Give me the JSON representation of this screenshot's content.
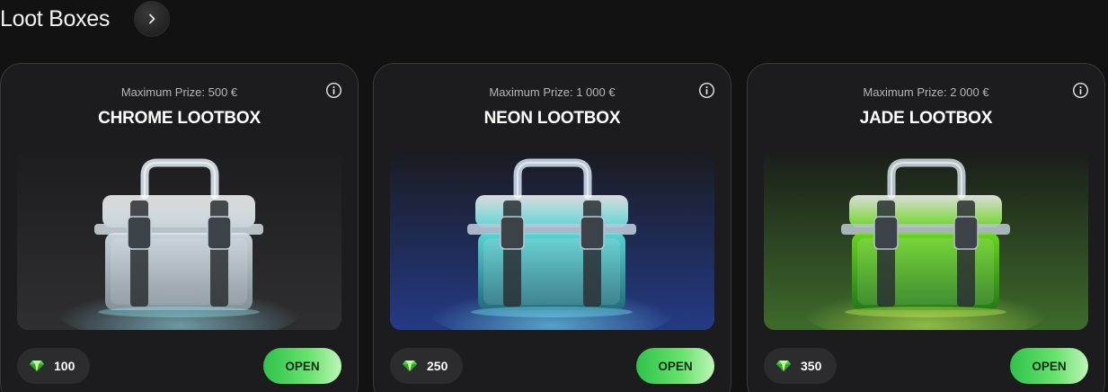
{
  "header": {
    "title": "Loot Boxes"
  },
  "cards": [
    {
      "prize": "Maximum Prize: 500 €",
      "name": "CHROME LOOTBOX",
      "price": "100",
      "open_label": "OPEN",
      "colors": {
        "bg_top": "#1d1d1f",
        "bg_bottom": "#2f2f32",
        "body": "#d9e6ec",
        "body_dark": "#8a98a0",
        "glow": "#9ff0ff",
        "handle": "#c7d2d8"
      }
    },
    {
      "prize": "Maximum Prize: 1 000 €",
      "name": "NEON LOOTBOX",
      "price": "250",
      "open_label": "OPEN",
      "colors": {
        "bg_top": "#1a1b20",
        "bg_bottom": "#243a86",
        "body": "#5fe6e0",
        "body_dark": "#1f6f7a",
        "glow": "#7ef7ff",
        "handle": "#b9c7d6"
      }
    },
    {
      "prize": "Maximum Prize: 2 000 €",
      "name": "JADE LOOTBOX",
      "price": "350",
      "open_label": "OPEN",
      "colors": {
        "bg_top": "#1b1d1a",
        "bg_bottom": "#3d6b2a",
        "body": "#6fe51f",
        "body_dark": "#1f7a12",
        "glow": "#d2ff5a",
        "handle": "#b6c2c8"
      }
    }
  ]
}
